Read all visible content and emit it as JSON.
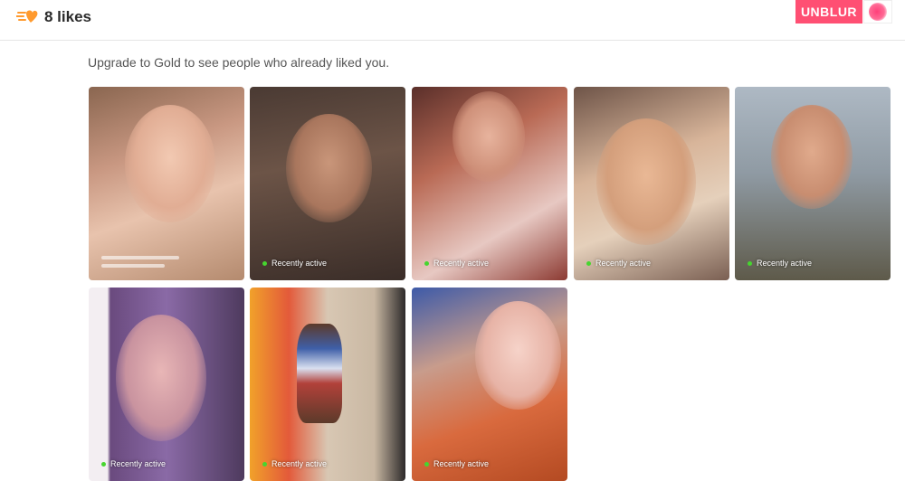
{
  "header": {
    "likes_title": "8 likes",
    "unblur_label": "UNBLUR",
    "icon": "likes-icon",
    "accent_color": "#ff4f73"
  },
  "main": {
    "upgrade_text": "Upgrade to Gold to see people who already liked you.",
    "cards": [
      {
        "status": ""
      },
      {
        "status": "Recently active"
      },
      {
        "status": "Recently active"
      },
      {
        "status": "Recently active"
      },
      {
        "status": "Recently active"
      },
      {
        "status": "Recently active"
      },
      {
        "status": "Recently active"
      },
      {
        "status": "Recently active"
      }
    ],
    "status_color": "#46d52f"
  }
}
